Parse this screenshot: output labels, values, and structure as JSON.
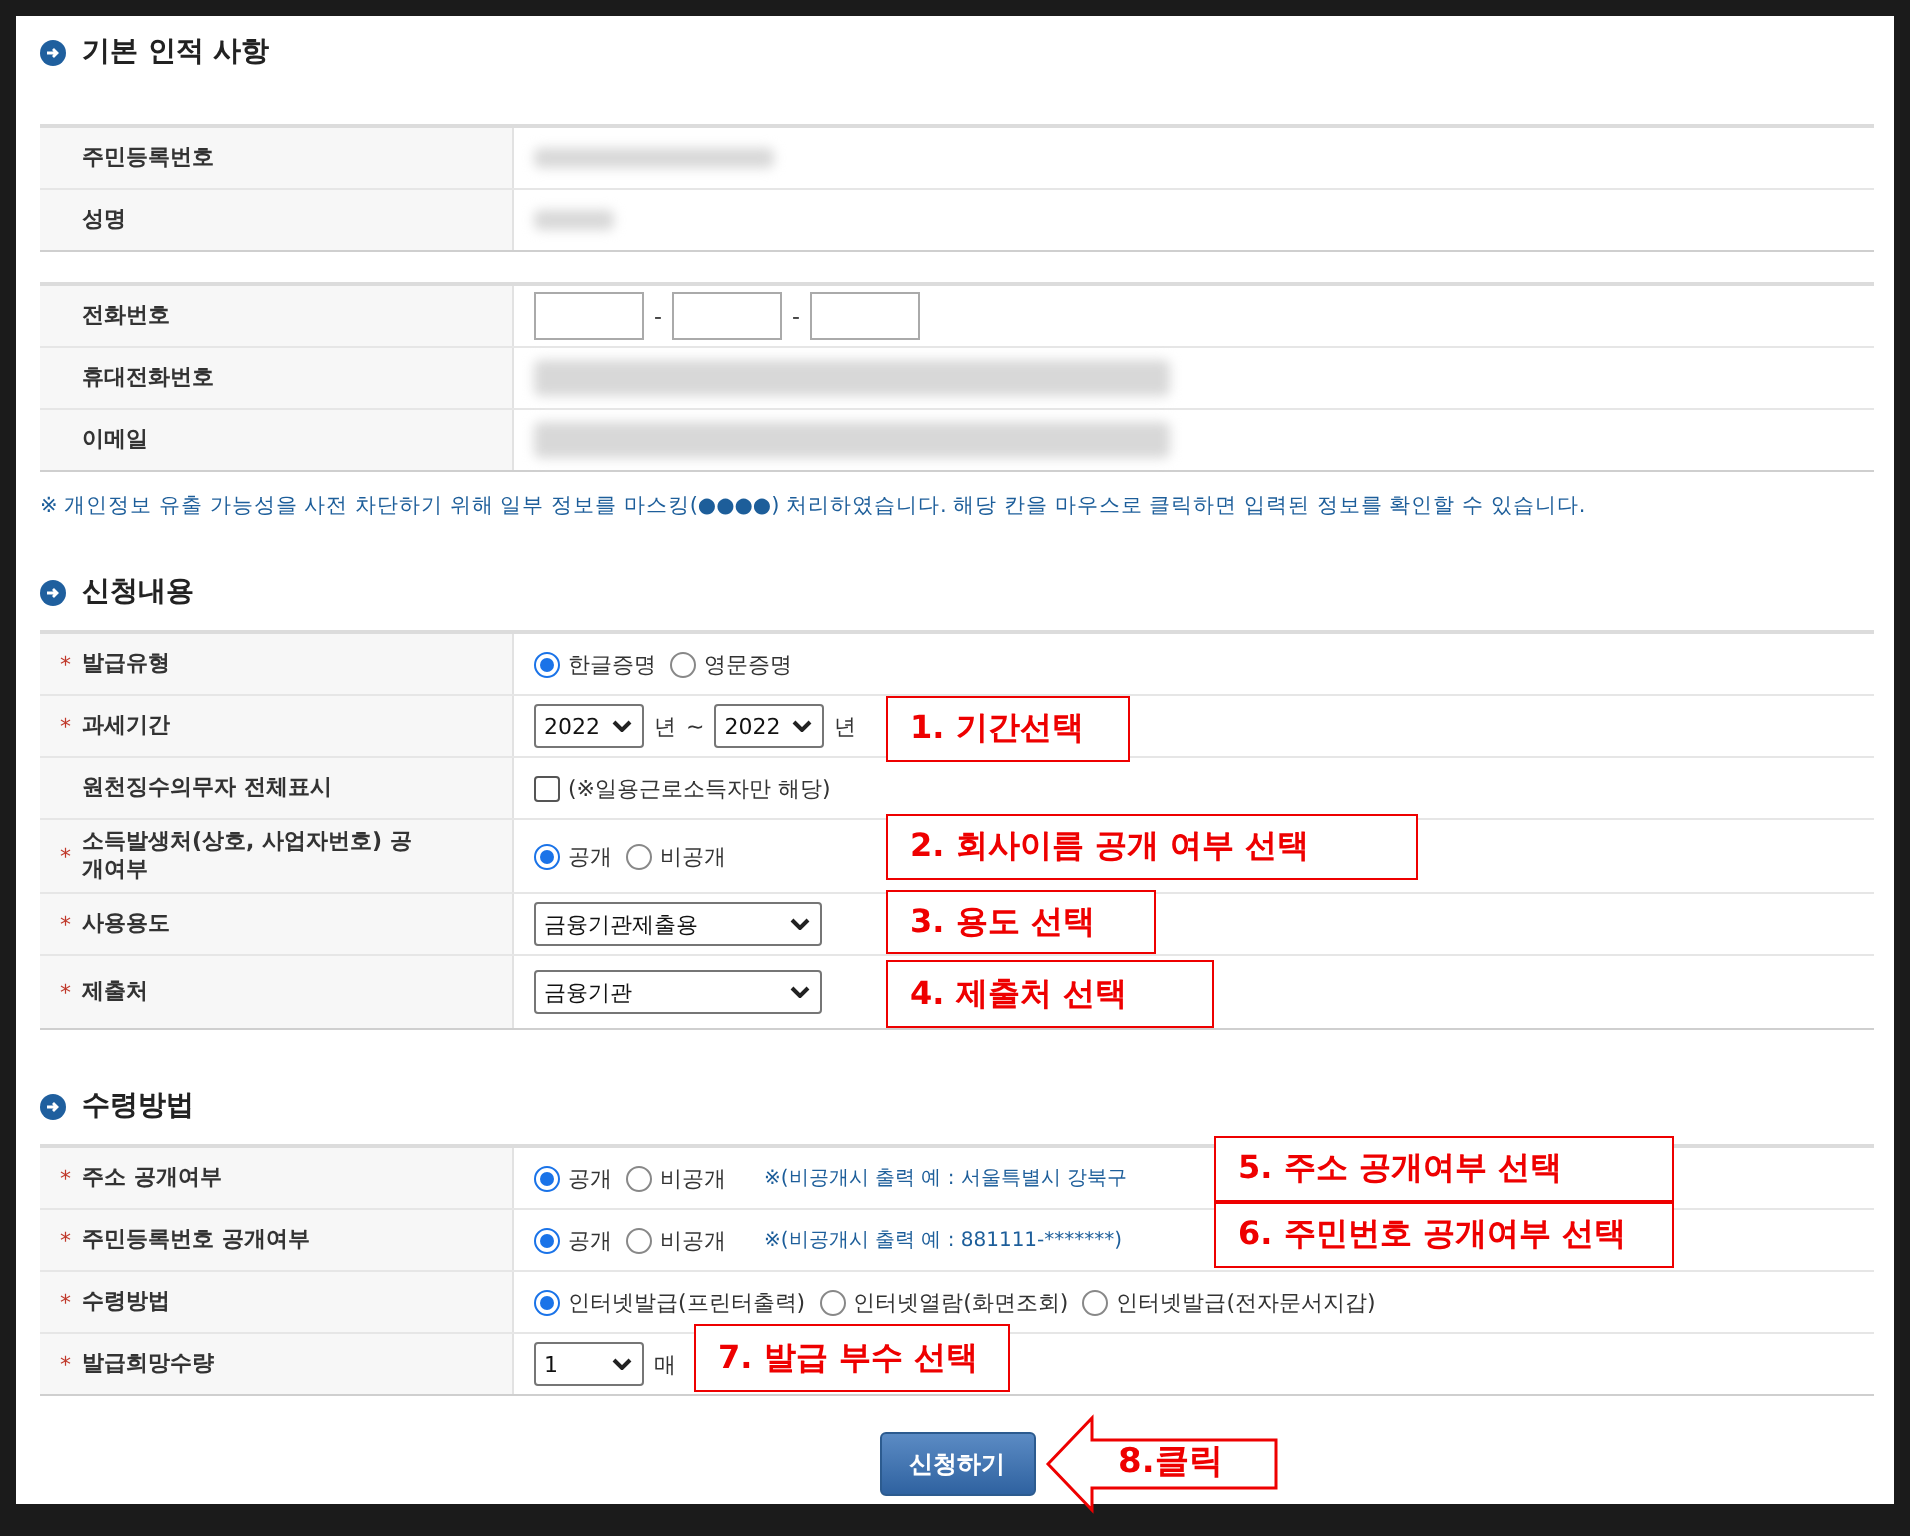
{
  "sections": [
    {
      "title": "기본 인적 사항",
      "tables": [
        {
          "rows": [
            {
              "label": "주민등록번호",
              "controls": [
                {
                  "kind": "masked"
                }
              ]
            },
            {
              "label": "성명",
              "controls": [
                {
                  "kind": "masked_short"
                }
              ]
            }
          ]
        },
        {
          "rows": [
            {
              "label": "전화번호",
              "controls": [
                {
                  "kind": "input"
                },
                {
                  "kind": "text",
                  "text": "-"
                },
                {
                  "kind": "input"
                },
                {
                  "kind": "text",
                  "text": "-"
                },
                {
                  "kind": "input"
                }
              ]
            },
            {
              "label": "휴대전화번호",
              "controls": [
                {
                  "kind": "masked_fields"
                }
              ]
            },
            {
              "label": "이메일",
              "controls": [
                {
                  "kind": "masked_fields"
                }
              ]
            }
          ]
        }
      ],
      "note": "※ 개인정보 유출 가능성을 사전 차단하기 위해 일부 정보를 마스킹(●●●●) 처리하였습니다. 해당 칸을 마우스로 클릭하면 입력된 정보를 확인할 수 있습니다."
    },
    {
      "title": "신청내용",
      "tables": [
        {
          "rows": [
            {
              "label": "발급유형",
              "required_mark": "*",
              "controls": [
                {
                  "kind": "radio",
                  "label": "한글증명",
                  "selected": true
                },
                {
                  "kind": "radio",
                  "label": "영문증명",
                  "selected": false
                }
              ]
            },
            {
              "label": "과세기간",
              "required_mark": "*",
              "controls": [
                {
                  "kind": "select",
                  "value": "2022",
                  "wide": false
                },
                {
                  "kind": "text",
                  "text": "년"
                },
                {
                  "kind": "text",
                  "text": "~"
                },
                {
                  "kind": "select",
                  "value": "2022",
                  "wide": false
                },
                {
                  "kind": "text",
                  "text": "년"
                }
              ]
            },
            {
              "label": "원천징수의무자 전체표시",
              "controls": [
                {
                  "kind": "checkbox",
                  "label": "(※일용근로소득자만 해당)",
                  "checked": false
                }
              ]
            },
            {
              "label": "소득발생처(상호, 사업자번호) 공개여부",
              "required_mark": "*",
              "controls": [
                {
                  "kind": "radio",
                  "label": "공개",
                  "selected": true
                },
                {
                  "kind": "radio",
                  "label": "비공개",
                  "selected": false
                }
              ]
            },
            {
              "label": "사용용도",
              "required_mark": "*",
              "controls": [
                {
                  "kind": "select",
                  "value": "금융기관제출용",
                  "wide": true
                }
              ]
            },
            {
              "label": "제출처",
              "required_mark": "*",
              "controls": [
                {
                  "kind": "select",
                  "value": "금융기관",
                  "wide": true
                }
              ]
            }
          ]
        }
      ]
    },
    {
      "title": "수령방법",
      "tables": [
        {
          "rows": [
            {
              "label": "주소 공개여부",
              "required_mark": "*",
              "controls": [
                {
                  "kind": "radio",
                  "label": "공개",
                  "selected": true
                },
                {
                  "kind": "radio",
                  "label": "비공개",
                  "selected": false
                },
                {
                  "kind": "note",
                  "text": "※(비공개시 출력 예 : 서울특별시 강북구"
                }
              ]
            },
            {
              "label": "주민등록번호 공개여부",
              "required_mark": "*",
              "controls": [
                {
                  "kind": "radio",
                  "label": "공개",
                  "selected": true
                },
                {
                  "kind": "radio",
                  "label": "비공개",
                  "selected": false
                },
                {
                  "kind": "note",
                  "text": "※(비공개시 출력 예 : 881111-*******)"
                }
              ]
            },
            {
              "label": "수령방법",
              "required_mark": "*",
              "controls": [
                {
                  "kind": "radio",
                  "label": "인터넷발급(프린터출력)",
                  "selected": true
                },
                {
                  "kind": "radio",
                  "label": "인터넷열람(화면조회)",
                  "selected": false
                },
                {
                  "kind": "radio",
                  "label": "인터넷발급(전자문서지갑)",
                  "selected": false
                }
              ]
            },
            {
              "label": "발급희망수량",
              "required_mark": "*",
              "controls": [
                {
                  "kind": "select",
                  "value": "1",
                  "wide": false
                },
                {
                  "kind": "text",
                  "text": "매"
                }
              ]
            }
          ]
        }
      ]
    }
  ],
  "submit_button": "신청하기",
  "annotations": [
    "1. 기간선택",
    "2. 회사이름 공개 여부 선택",
    "3. 용도 선택",
    "4. 제출처 선택",
    "5. 주소 공개여부 선택",
    "6. 주민번호 공개여부 선택",
    "7. 발급 부수 선택"
  ],
  "arrow_label": "8.클릭"
}
